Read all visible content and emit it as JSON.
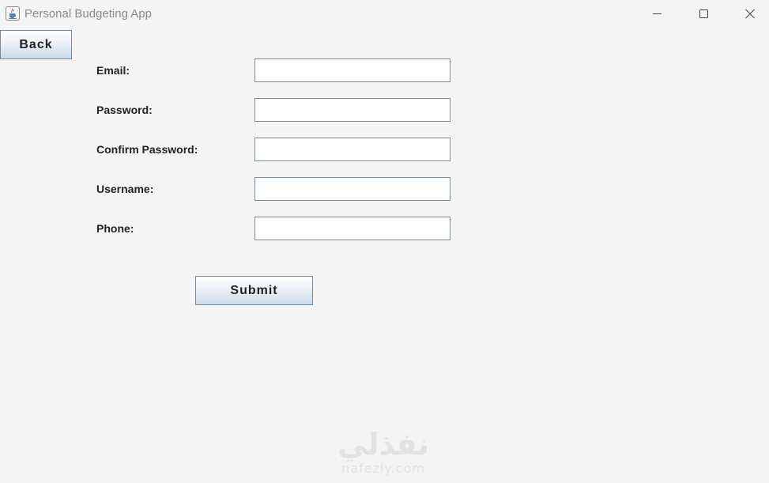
{
  "window": {
    "title": "Personal Budgeting App",
    "icon": "java-cup-icon",
    "controls": {
      "minimize": "minimize-icon",
      "maximize": "maximize-icon",
      "close": "close-icon"
    }
  },
  "toolbar": {
    "back_label": "Back"
  },
  "form": {
    "fields": [
      {
        "label": "Email:",
        "value": "",
        "placeholder": ""
      },
      {
        "label": "Password:",
        "value": "",
        "placeholder": ""
      },
      {
        "label": "Confirm Password:",
        "value": "",
        "placeholder": ""
      },
      {
        "label": "Username:",
        "value": "",
        "placeholder": ""
      },
      {
        "label": "Phone:",
        "value": "",
        "placeholder": ""
      }
    ],
    "submit_label": "Submit"
  },
  "watermark": {
    "arabic": "نفذلي",
    "latin": "nafezly.com"
  },
  "colors": {
    "background": "#f4f4f4",
    "title_text": "#8a8a8a",
    "input_border": "#7a8a99",
    "button_gradient_bottom": "#c8dae9"
  }
}
